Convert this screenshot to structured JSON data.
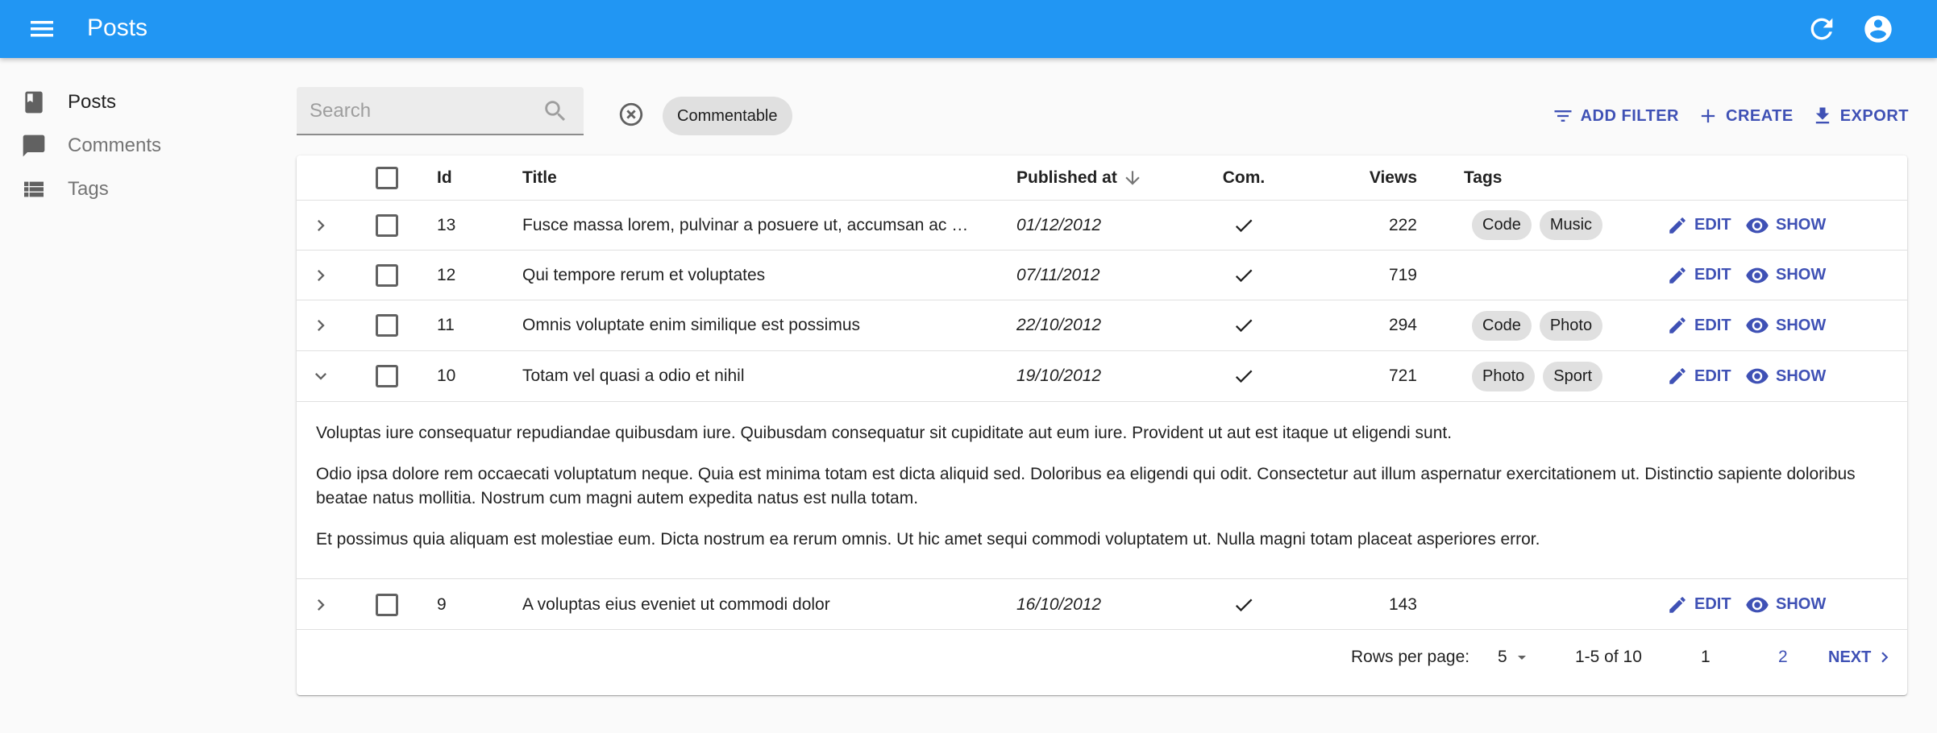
{
  "app": {
    "title": "Posts"
  },
  "sidebar": {
    "items": [
      {
        "label": "Posts",
        "icon": "book-icon",
        "active": true
      },
      {
        "label": "Comments",
        "icon": "comment-icon",
        "active": false
      },
      {
        "label": "Tags",
        "icon": "list-icon",
        "active": false
      }
    ]
  },
  "toolbar": {
    "search_placeholder": "Search",
    "filter_chip": "Commentable",
    "add_filter": "ADD FILTER",
    "create": "CREATE",
    "export": "EXPORT"
  },
  "table": {
    "headers": {
      "id": "Id",
      "title": "Title",
      "published_at": "Published at",
      "com": "Com.",
      "views": "Views",
      "tags": "Tags"
    },
    "edit_label": "EDIT",
    "show_label": "SHOW",
    "rows": [
      {
        "id": "13",
        "title": "Fusce massa lorem, pulvinar a posuere ut, accumsan ac …",
        "date": "01/12/2012",
        "views": "222",
        "tags": [
          "Code",
          "Music"
        ]
      },
      {
        "id": "12",
        "title": "Qui tempore rerum et voluptates",
        "date": "07/11/2012",
        "views": "719",
        "tags": []
      },
      {
        "id": "11",
        "title": "Omnis voluptate enim similique est possimus",
        "date": "22/10/2012",
        "views": "294",
        "tags": [
          "Code",
          "Photo"
        ]
      },
      {
        "id": "10",
        "title": "Totam vel quasi a odio et nihil",
        "date": "19/10/2012",
        "views": "721",
        "tags": [
          "Photo",
          "Sport"
        ]
      },
      {
        "id": "9",
        "title": "A voluptas eius eveniet ut commodi dolor",
        "date": "16/10/2012",
        "views": "143",
        "tags": []
      }
    ],
    "expanded_body": [
      "Voluptas iure consequatur repudiandae quibusdam iure. Quibusdam consequatur sit cupiditate aut eum iure. Provident ut aut est itaque ut eligendi sunt.",
      "Odio ipsa dolore rem occaecati voluptatum neque. Quia est minima totam est dicta aliquid sed. Doloribus ea eligendi qui odit. Consectetur aut illum aspernatur exercitationem ut. Distinctio sapiente doloribus beatae natus mollitia. Nostrum cum magni autem expedita natus est nulla totam.",
      "Et possimus quia aliquam est molestiae eum. Dicta nostrum ea rerum omnis. Ut hic amet sequi commodi voluptatem ut. Nulla magni totam placeat asperiores error."
    ]
  },
  "pagination": {
    "rows_per_page_label": "Rows per page:",
    "rows_per_page": "5",
    "range": "1-5 of 10",
    "pages": [
      "1",
      "2"
    ],
    "next": "NEXT"
  },
  "colors": {
    "appbar": "#2196f3",
    "accent": "#3f51b5"
  }
}
